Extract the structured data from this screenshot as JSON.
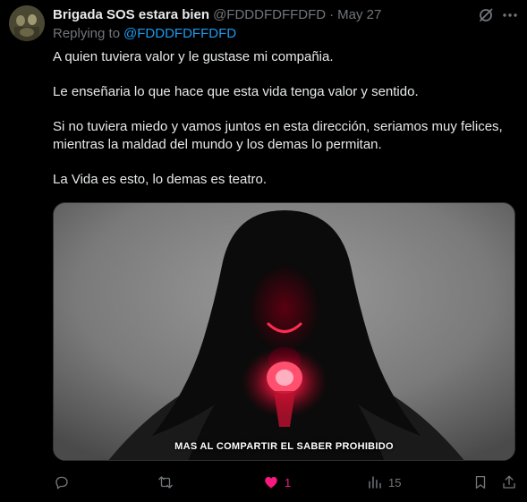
{
  "tweet": {
    "author_name": "Brigada SOS estara bien",
    "handle": "@FDDDFDFFDFD",
    "separator": "·",
    "date": "May 27",
    "replying_prefix": "Replying to",
    "replying_handle": "@FDDDFDFFDFD",
    "paragraphs": [
      "A quien tuviera valor y le gustase mi compañia.",
      "Le enseñaria lo que hace que esta vida tenga valor y sentido.",
      "Si no tuviera miedo y vamos juntos en esta dirección, seriamos muy felices, mientras la maldad del mundo y los demas lo permitan.",
      "La Vida es esto, lo demas es teatro."
    ],
    "media": {
      "caption": "MAS AL COMPARTIR EL SABER PROHIBIDO"
    },
    "actions": {
      "reply_icon": "reply-icon",
      "retweet_icon": "retweet-icon",
      "like_icon": "heart-filled-icon",
      "like_count": "1",
      "views_icon": "views-icon",
      "views_count": "15",
      "bookmark_icon": "bookmark-icon",
      "share_icon": "share-icon"
    }
  },
  "colors": {
    "background": "#000000",
    "text_primary": "#e7e9ea",
    "text_secondary": "#71767b",
    "link": "#1d9bf0",
    "like": "#f91880"
  }
}
